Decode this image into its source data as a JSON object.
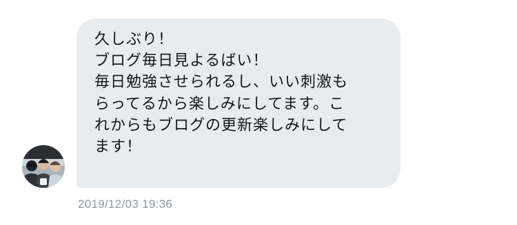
{
  "conversation": {
    "message": {
      "lines": [
        "久しぶり！",
        "ブログ毎日見よるばい！",
        "毎日勉強させられるし、いい刺激も",
        "らってるから楽しみにしてます。こ",
        "れからもブログの更新楽しみにして",
        "ます！"
      ],
      "timestamp": "2019/12/03 19:36"
    },
    "sender": {
      "avatar_icon": "group-photo-avatar"
    }
  },
  "colors": {
    "bubble_background": "#e6ecf0",
    "message_text": "#14171a",
    "timestamp_text": "#8c96a0"
  }
}
